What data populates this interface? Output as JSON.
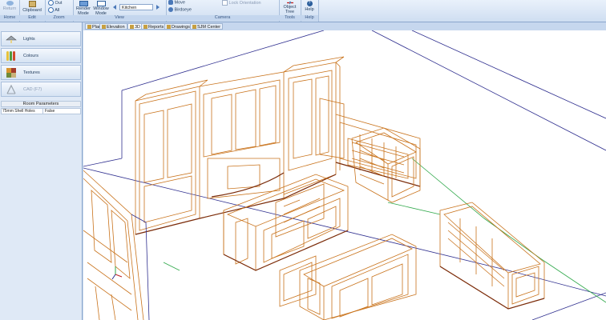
{
  "ribbon": {
    "groups": [
      {
        "label": "Home"
      },
      {
        "label": "Edit"
      },
      {
        "label": "Zoom"
      },
      {
        "label": "View"
      },
      {
        "label": "Camera"
      },
      {
        "label": "Tools"
      },
      {
        "label": "Help"
      }
    ],
    "return_label": "Return",
    "clipboard_label": "Clipboard",
    "zoom_out_label": "Out",
    "zoom_all_label": "All",
    "render_mode_label": "Render Mode",
    "window_mode_label": "Window Mode",
    "room_select_value": "Kitchen",
    "move_label": "Move",
    "birdseye_label": "Birdseye",
    "lock_orientation_label": "Lock Orientation",
    "object_tree_label": "Object Tree",
    "help_label": "Help"
  },
  "left_panel": {
    "buttons": [
      {
        "label": "Lights",
        "icon": "lamp-icon"
      },
      {
        "label": "Colours",
        "icon": "paint-swatch-icon"
      },
      {
        "label": "Textures",
        "icon": "texture-icon"
      },
      {
        "label": "CAD (F7)",
        "icon": "cad-icon"
      }
    ],
    "params_title": "Room Parameters",
    "params": [
      {
        "name": "75mm Shell Holes",
        "value": "False"
      }
    ]
  },
  "tabs": [
    {
      "label": "Plan"
    },
    {
      "label": "Elevation"
    },
    {
      "label": "3D"
    },
    {
      "label": "Reports"
    },
    {
      "label": "Drawings"
    },
    {
      "label": "SJM Center"
    }
  ],
  "colors": {
    "wire_orange": "#c9731c",
    "wire_dark": "#7a2b0a",
    "wire_room": "#2f2f8f",
    "floor_green": "#2fa84a",
    "ribbon_bg": "#dbe7f6"
  }
}
